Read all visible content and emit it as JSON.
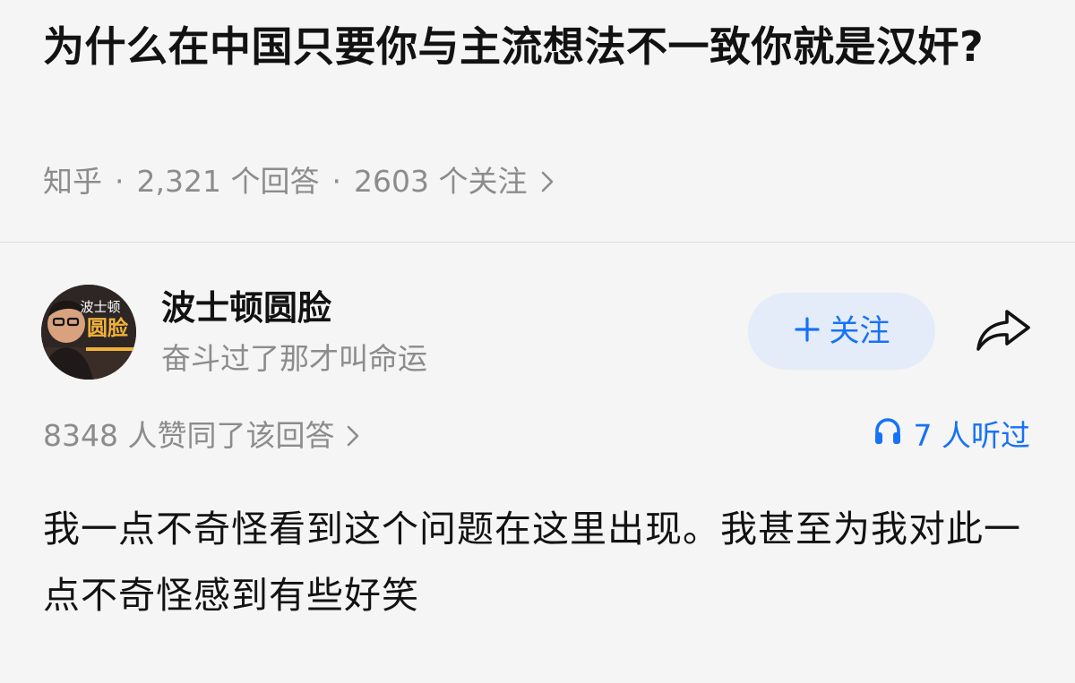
{
  "question": {
    "title": "为什么在中国只要你与主流想法不一致你就是汉奸?",
    "source": "知乎",
    "answers": "2,321 个回答",
    "followers": "2603 个关注"
  },
  "author": {
    "name": "波士顿圆脸",
    "signature": "奋斗过了那才叫命运",
    "avatar_text_top": "波士顿",
    "avatar_text_main": "圆脸"
  },
  "actions": {
    "follow_label": "关注",
    "follow_icon": "plus-icon",
    "share_icon": "share-arrow-icon"
  },
  "stats": {
    "upvotes": "8348 人赞同了该回答",
    "listens": "7 人听过",
    "listen_icon": "headphones-icon"
  },
  "answer": {
    "text": "我一点不奇怪看到这个问题在这里出现。我甚至为我对此一点不奇怪感到有些好笑"
  },
  "colors": {
    "accent": "#1772f6",
    "follow_bg": "#e3ecf8",
    "background": "#f5f5f5",
    "meta_text": "#8c8c8c"
  }
}
